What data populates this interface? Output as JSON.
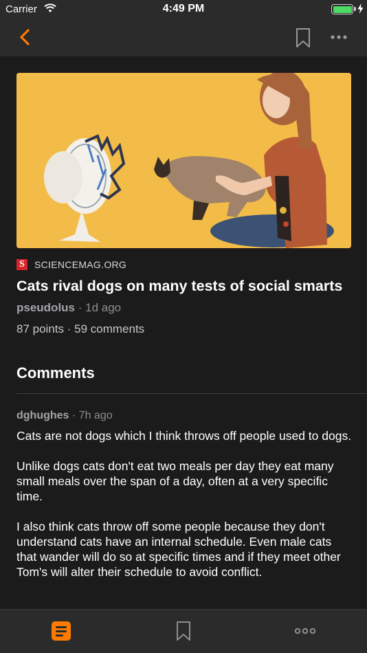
{
  "status_bar": {
    "carrier": "Carrier",
    "time": "4:49 PM",
    "battery_level": 1.0
  },
  "nav": {
    "back_icon": "chevron-left-icon",
    "bookmark_icon": "bookmark-icon",
    "more_icon": "ellipsis-icon",
    "accent_color": "#ff7a00"
  },
  "story": {
    "source_logo": "S",
    "source": "SCIENCEMAG.ORG",
    "title": "Cats rival dogs on many tests of social smarts",
    "author": "pseudolus",
    "age": "1d ago",
    "points": "87 points",
    "comments_count": "59 comments"
  },
  "comments_section": {
    "heading": "Comments",
    "items": [
      {
        "author": "dghughes",
        "age": "7h ago",
        "paragraphs": [
          "Cats are not dogs which I think throws off people used to dogs.",
          "Unlike dogs cats don't eat two meals per day they eat many small meals over the span of a day, often at a very specific time.",
          "I also think cats throw off some people because they don't understand cats have an internal schedule. Even male cats that wander will do so at specific times and if they meet other Tom's will alter their schedule to avoid conflict."
        ]
      }
    ]
  },
  "tab_bar": {
    "items": [
      {
        "icon": "stories-icon",
        "active": true
      },
      {
        "icon": "bookmark-icon",
        "active": false
      },
      {
        "icon": "more-icon",
        "active": false
      }
    ]
  }
}
